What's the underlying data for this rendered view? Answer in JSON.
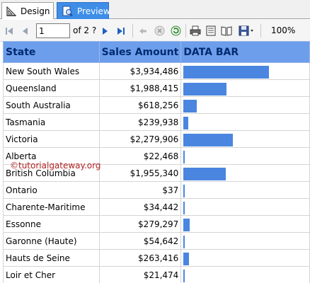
{
  "tabs": [
    {
      "label": "Design",
      "icon": "design-icon",
      "selected": false
    },
    {
      "label": "Preview",
      "icon": "preview-icon",
      "selected": true
    }
  ],
  "toolbar": {
    "current_page": "1",
    "of_label": "of 2 ?",
    "zoom": "100%"
  },
  "table": {
    "headers": [
      "State",
      "Sales Amount",
      "DATA BAR"
    ],
    "bar_color": "#4a86e0",
    "header_color": "#6d9eeb",
    "max_sales": 3934486,
    "rows": [
      {
        "state": "New South Wales",
        "amount": "$3,934,486",
        "value": 3934486
      },
      {
        "state": "Queensland",
        "amount": "$1,988,415",
        "value": 1988415
      },
      {
        "state": "South Australia",
        "amount": "$618,256",
        "value": 618256
      },
      {
        "state": "Tasmania",
        "amount": "$239,938",
        "value": 239938
      },
      {
        "state": "Victoria",
        "amount": "$2,279,906",
        "value": 2279906
      },
      {
        "state": "Alberta",
        "amount": "$22,468",
        "value": 22468
      },
      {
        "state": "British Columbia",
        "amount": "$1,955,340",
        "value": 1955340
      },
      {
        "state": "Ontario",
        "amount": "$37",
        "value": 37
      },
      {
        "state": "Charente-Maritime",
        "amount": "$34,442",
        "value": 34442
      },
      {
        "state": "Essonne",
        "amount": "$279,297",
        "value": 279297
      },
      {
        "state": "Garonne (Haute)",
        "amount": "$54,642",
        "value": 54642
      },
      {
        "state": "Hauts de Seine",
        "amount": "$263,416",
        "value": 263416
      },
      {
        "state": "Loir et Cher",
        "amount": "$21,474",
        "value": 21474
      }
    ]
  },
  "watermark": "©tutorialgateway.org"
}
